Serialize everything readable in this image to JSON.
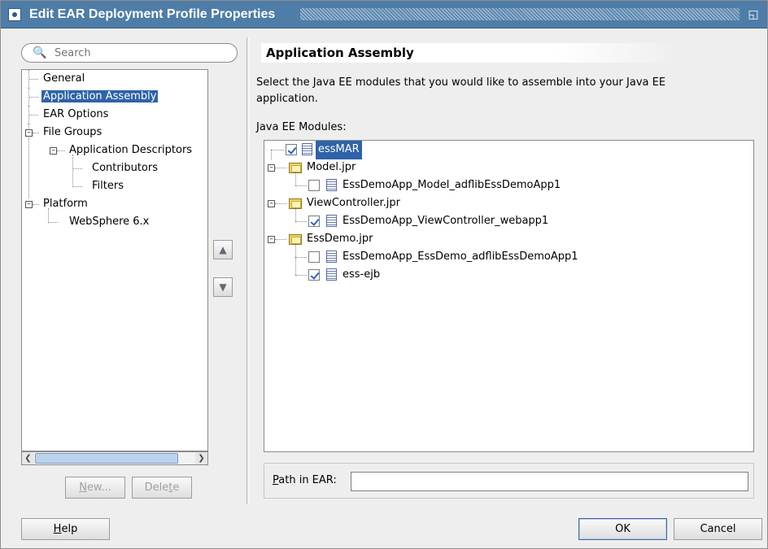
{
  "window": {
    "title": "Edit EAR Deployment Profile Properties"
  },
  "search": {
    "placeholder": "Search"
  },
  "nav": {
    "general": "General",
    "application_assembly": "Application Assembly",
    "ear_options": "EAR Options",
    "file_groups": "File Groups",
    "application_descriptors": "Application Descriptors",
    "contributors": "Contributors",
    "filters": "Filters",
    "platform": "Platform",
    "websphere": "WebSphere 6.x"
  },
  "left_buttons": {
    "new_pre": "",
    "new_mn": "N",
    "new_post": "ew...",
    "delete_pre": "Dele",
    "delete_mn": "t",
    "delete_post": "e"
  },
  "panel": {
    "header": "Application Assembly",
    "description": "Select the Java EE modules that you would like to assemble into your Java EE application.",
    "modules_label": "Java EE Modules:"
  },
  "modules": {
    "essmar": "essMAR",
    "model_jpr": "Model.jpr",
    "model_lib": "EssDemoApp_Model_adflibEssDemoApp1",
    "viewcontroller_jpr": "ViewController.jpr",
    "viewcontroller_webapp": "EssDemoApp_ViewController_webapp1",
    "essdemo_jpr": "EssDemo.jpr",
    "essdemo_lib": "EssDemoApp_EssDemo_adflibEssDemoApp1",
    "ess_ejb": "ess-ejb"
  },
  "path": {
    "label_mn": "P",
    "label_rest": "ath in EAR:",
    "value": ""
  },
  "footer": {
    "help_mn": "H",
    "help_rest": "elp",
    "ok": "OK",
    "cancel": "Cancel"
  }
}
